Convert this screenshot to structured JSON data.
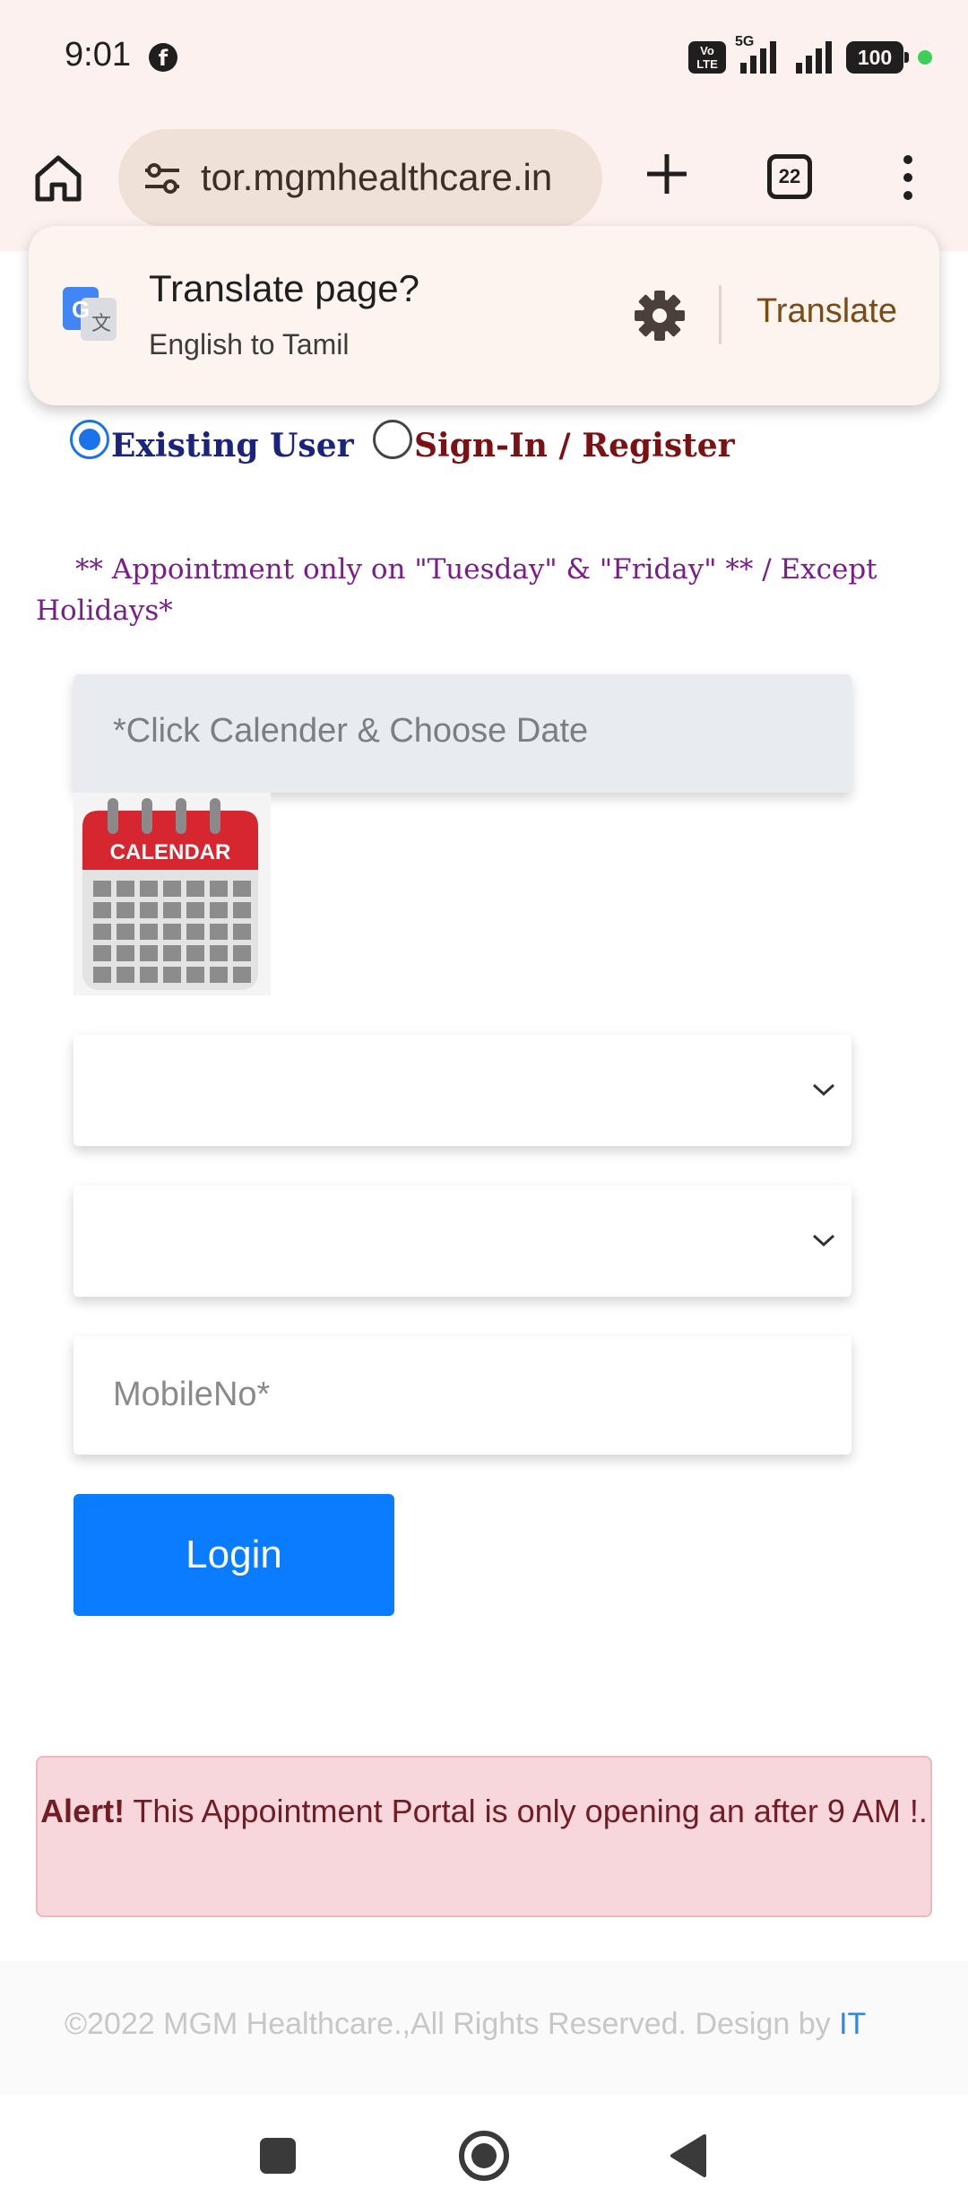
{
  "status_bar": {
    "time": "9:01",
    "app_icon": "facebook-icon",
    "volte": "Vo LTE",
    "network": "5G",
    "battery": "100"
  },
  "browser": {
    "url": "tor.mgmhealthcare.in",
    "tab_count": "22"
  },
  "translate": {
    "title": "Translate page?",
    "subtitle": "English to Tamil",
    "button": "Translate"
  },
  "form": {
    "radio_existing": "Existing User",
    "radio_register": "Sign-In / Register",
    "notice": "** Appointment only on \"Tuesday\" & \"Friday\" ** / Except Holidays*",
    "date_placeholder": "*Click Calender & Choose Date",
    "calendar_label": "CALENDAR",
    "mobile_placeholder": "MobileNo*",
    "login_label": "Login"
  },
  "alert": {
    "strong": "Alert!",
    "message": " This Appointment Portal is only opening an after 9 AM !."
  },
  "footer": {
    "copyright": "©2022 MGM Healthcare.,All Rights Reserved. Design by ",
    "link": "IT"
  },
  "colors": {
    "accent": "#0a7cff",
    "existing_label": "#1a237e",
    "register_label": "#7b1113",
    "notice": "#7a1d8a",
    "alert_bg": "#f7d7db"
  }
}
